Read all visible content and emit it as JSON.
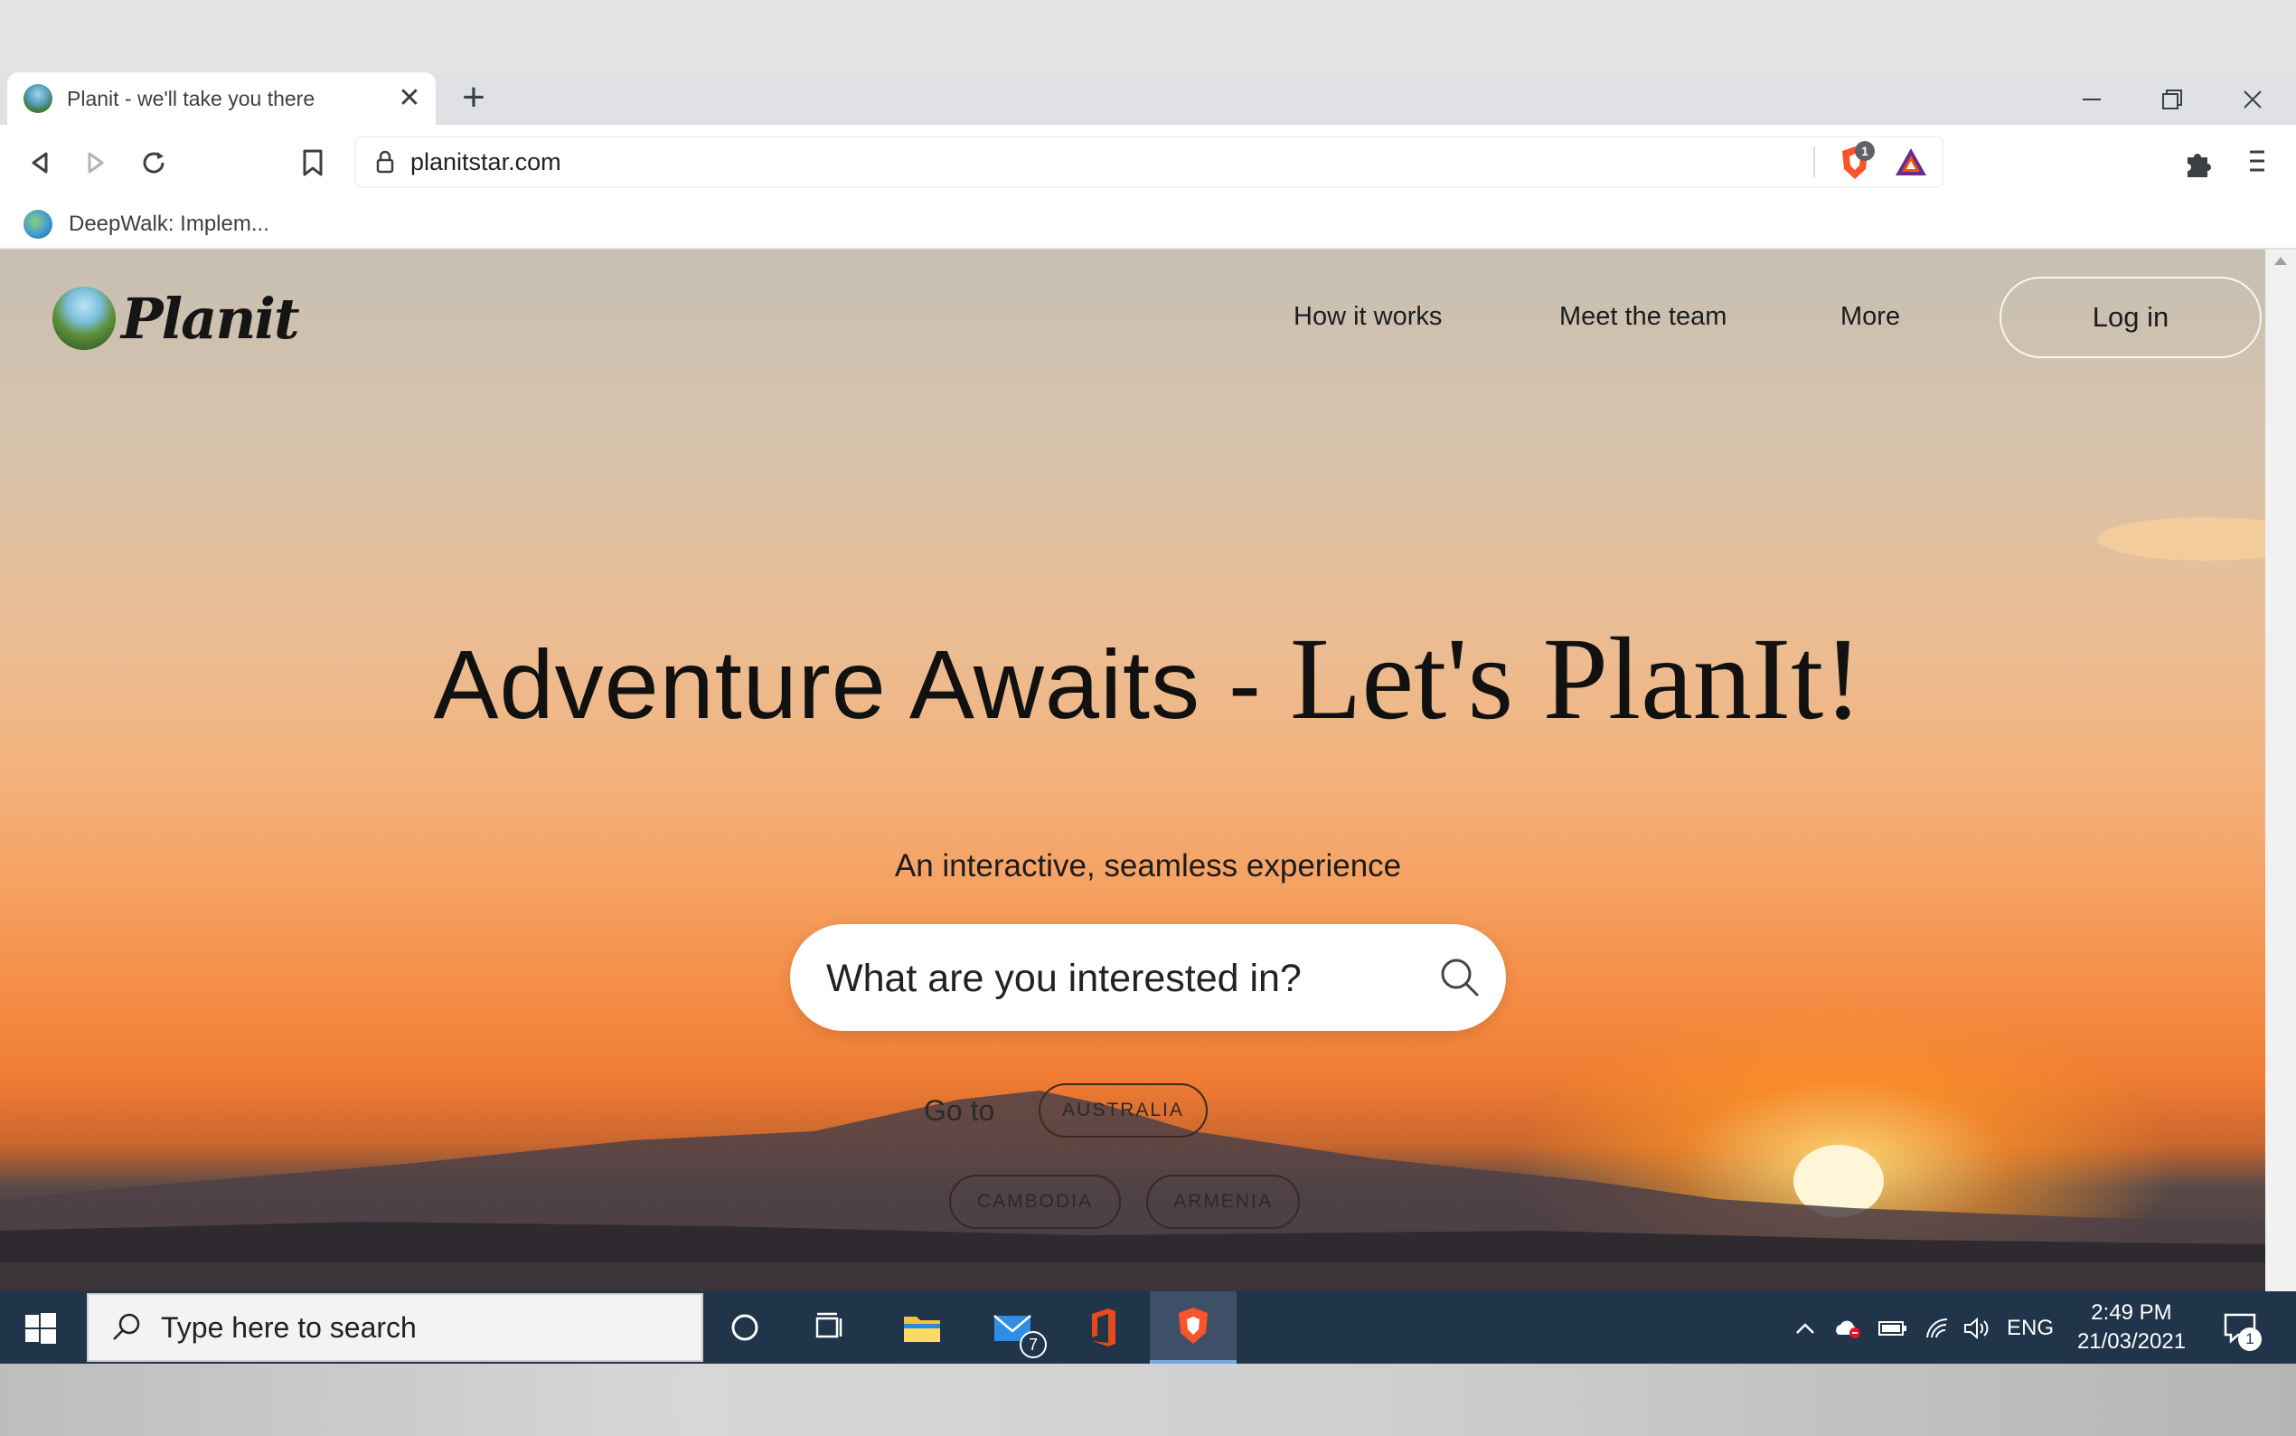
{
  "browser": {
    "tab_title": "Planit - we'll take you there",
    "new_tab": "+",
    "tab_close": "✕",
    "url": "planitstar.com",
    "shield_count": "1",
    "bookmark_label": "DeepWalk: Implem..."
  },
  "site": {
    "logo_text": "Planit",
    "nav": {
      "how": "How it works",
      "team": "Meet the team",
      "more": "More",
      "login": "Log in"
    },
    "hero": {
      "title_part1": "Adventure Awaits - ",
      "title_part2": "Let's PlanIt!",
      "subtitle": "An interactive, seamless experience"
    },
    "search": {
      "placeholder": "What are you interested in?"
    },
    "goto": {
      "label": "Go to",
      "destinations": [
        "AUSTRALIA",
        "CAMBODIA",
        "ARMENIA"
      ]
    }
  },
  "taskbar": {
    "search_placeholder": "Type here to search",
    "mail_badge": "7",
    "language": "ENG",
    "time": "2:49 PM",
    "date": "21/03/2021",
    "notification_count": "1"
  },
  "colors": {
    "accent_chip_border": "#3a2a1e",
    "taskbar_bg": "#20344a",
    "brave_orange": "#fb542b"
  }
}
